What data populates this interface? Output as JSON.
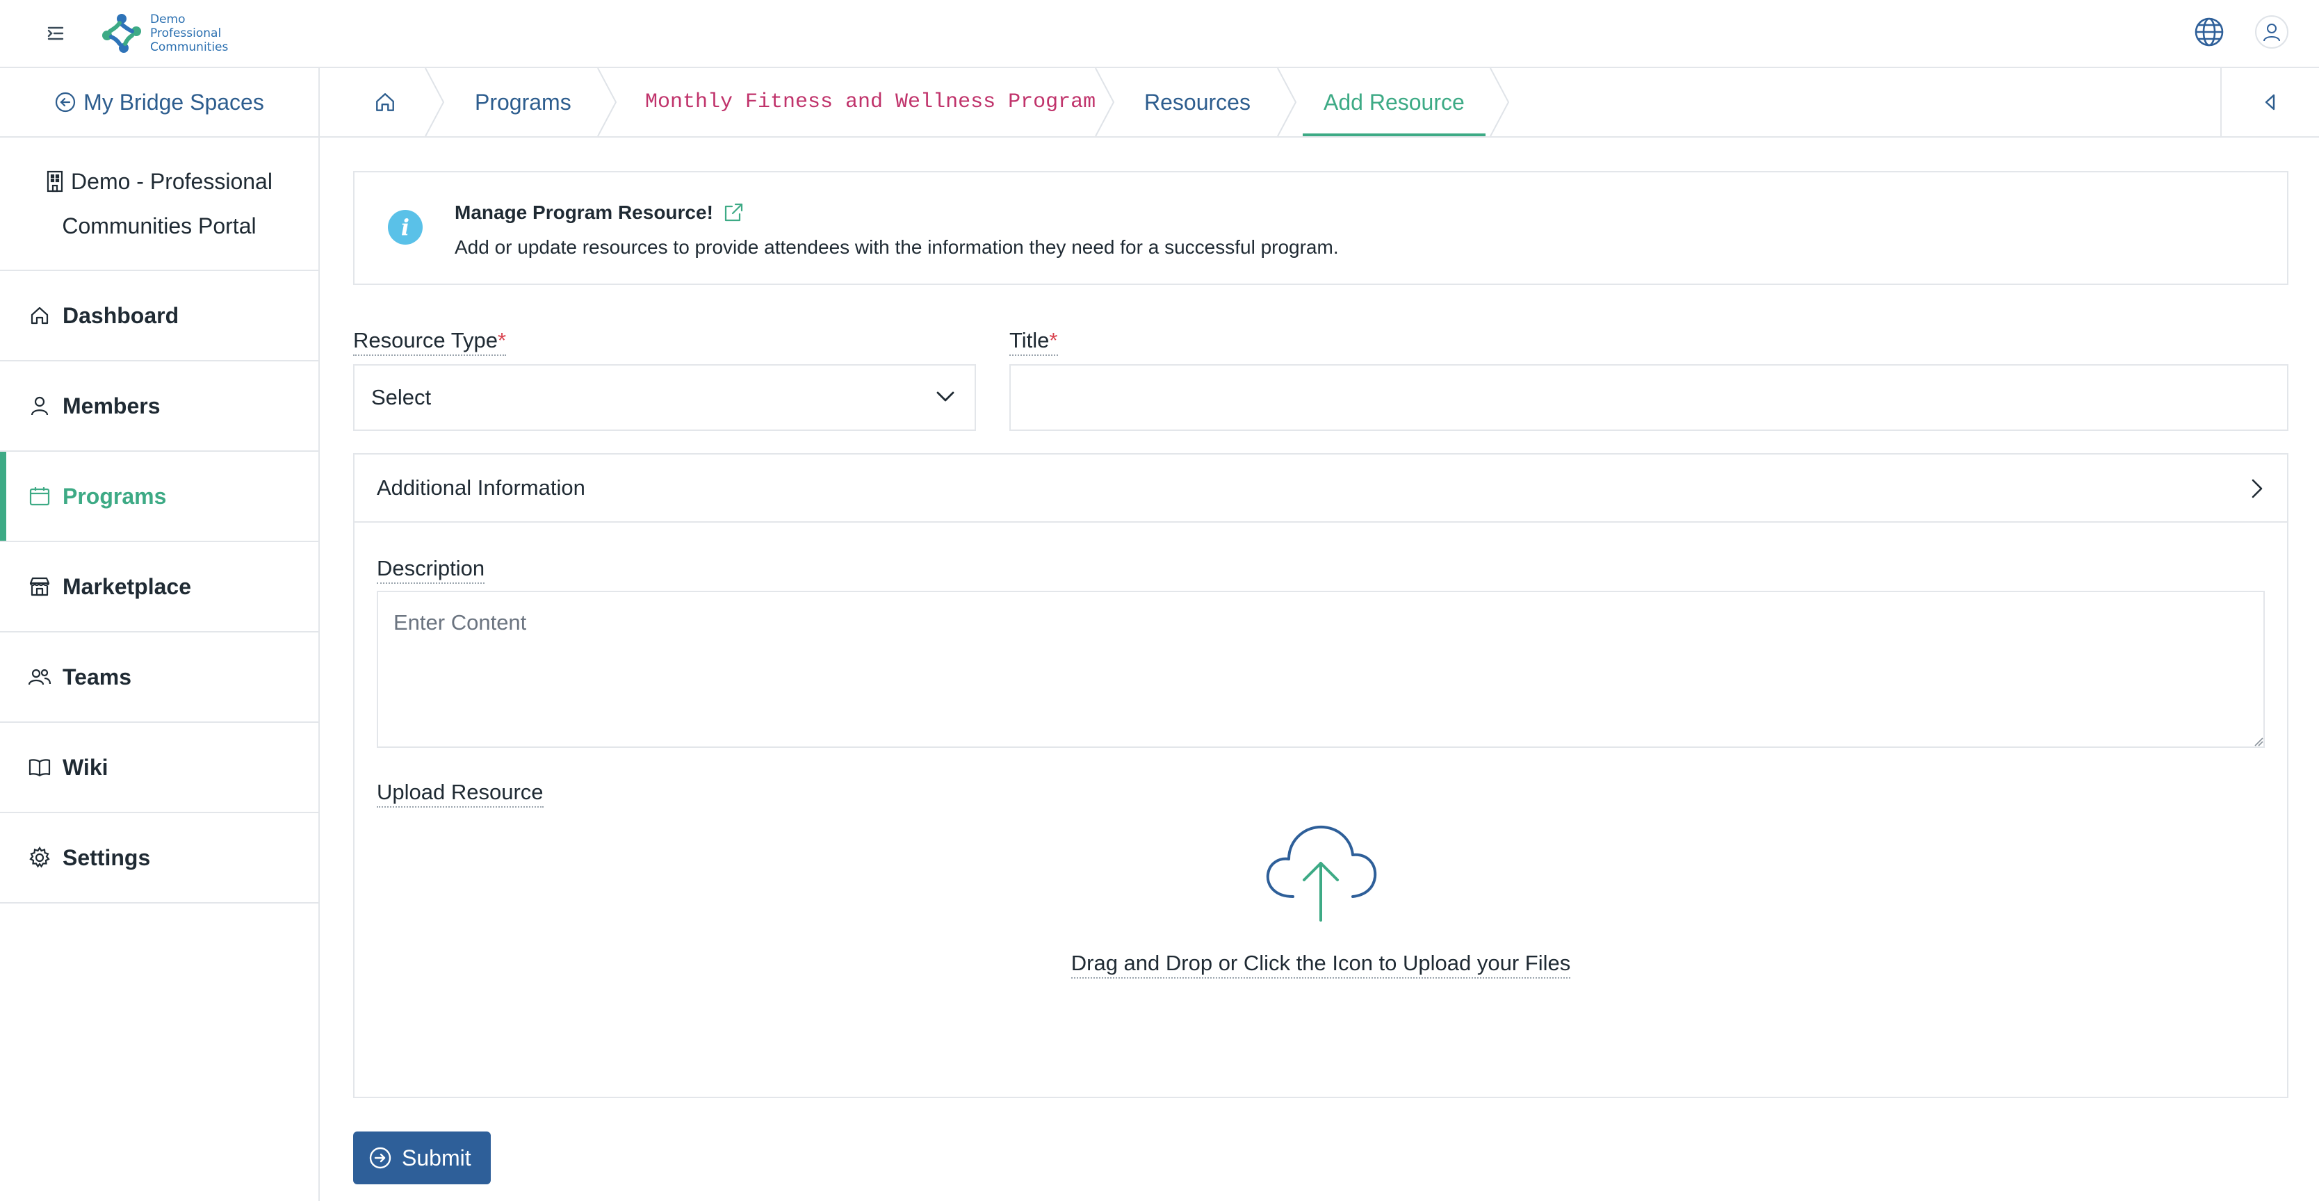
{
  "app": {
    "logo_lines": [
      "Demo",
      "Professional",
      "Communities"
    ]
  },
  "sidebar": {
    "back_label": "My Bridge Spaces",
    "portal_line1": "Demo - Professional",
    "portal_line2": "Communities Portal",
    "items": [
      {
        "label": "Dashboard",
        "icon": "home-icon"
      },
      {
        "label": "Members",
        "icon": "user-icon"
      },
      {
        "label": "Programs",
        "icon": "calendar-icon",
        "active": true
      },
      {
        "label": "Marketplace",
        "icon": "store-icon"
      },
      {
        "label": "Teams",
        "icon": "users-icon"
      },
      {
        "label": "Wiki",
        "icon": "book-icon"
      },
      {
        "label": "Settings",
        "icon": "gear-icon"
      }
    ]
  },
  "breadcrumb": {
    "items": [
      "Programs",
      "Monthly Fitness and Wellness Program",
      "Resources",
      "Add Resource"
    ]
  },
  "info": {
    "title": "Manage Program Resource!",
    "text": "Add or update resources to provide attendees with the information they need for a successful program."
  },
  "form": {
    "resource_type_label": "Resource Type",
    "required_mark": "*",
    "resource_type_value": "Select",
    "title_label": "Title",
    "title_value": "",
    "additional_info_label": "Additional Information",
    "description_label": "Description",
    "description_placeholder": "Enter Content",
    "upload_label": "Upload Resource",
    "upload_text": "Drag and Drop or Click the Icon to Upload your Files",
    "submit_label": "Submit"
  },
  "colors": {
    "accent_green": "#3daa85",
    "primary_blue": "#2e5f99",
    "link_blue": "#2d5d8e",
    "mono_magenta": "#c0336b",
    "required_red": "#d9434f",
    "info_blue": "#5ac1e8"
  }
}
